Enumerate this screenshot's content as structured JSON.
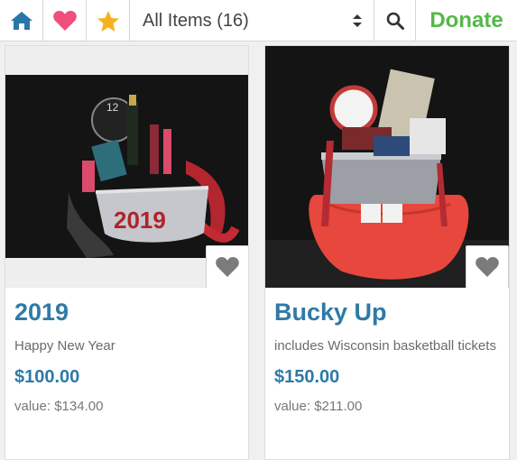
{
  "toolbar": {
    "home_icon": "home-icon",
    "heart_icon": "heart-icon",
    "star_icon": "star-icon",
    "filter_label": "All Items (16)",
    "search_icon": "search-icon",
    "donate_label": "Donate"
  },
  "colors": {
    "brand_blue": "#2a76a8",
    "heart_pink": "#ef4f7c",
    "star_gold": "#f6b21d",
    "donate_green": "#55b84a"
  },
  "items": [
    {
      "title": "2019",
      "description": "Happy New Year",
      "price": "$100.00",
      "value": "value: $134.00"
    },
    {
      "title": "Bucky Up",
      "description": "includes Wisconsin basketball tickets",
      "price": "$150.00",
      "value": "value: $211.00"
    }
  ]
}
